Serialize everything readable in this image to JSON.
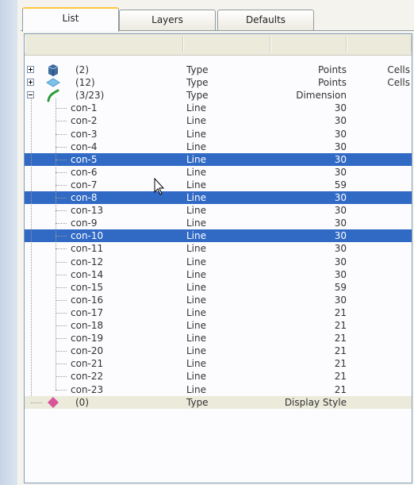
{
  "tabs": [
    {
      "label": "List",
      "active": true
    },
    {
      "label": "Layers",
      "active": false
    },
    {
      "label": "Defaults",
      "active": false
    }
  ],
  "tree": {
    "groups": [
      {
        "name": "(2)",
        "type": "Type",
        "col3": "Points",
        "col4": "Cells",
        "icon": "block-icon",
        "expanded": false
      },
      {
        "name": "(12)",
        "type": "Type",
        "col3": "Points",
        "col4": "Cells",
        "icon": "domain-icon",
        "expanded": false
      },
      {
        "name": "(3/23)",
        "type": "Type",
        "col3": "Dimension",
        "col4": "",
        "icon": "connector-icon",
        "expanded": true
      }
    ],
    "connectors": [
      {
        "name": "con-1",
        "type": "Line",
        "dim": "30",
        "selected": false
      },
      {
        "name": "con-2",
        "type": "Line",
        "dim": "30",
        "selected": false
      },
      {
        "name": "con-3",
        "type": "Line",
        "dim": "30",
        "selected": false
      },
      {
        "name": "con-4",
        "type": "Line",
        "dim": "30",
        "selected": false
      },
      {
        "name": "con-5",
        "type": "Line",
        "dim": "30",
        "selected": true
      },
      {
        "name": "con-6",
        "type": "Line",
        "dim": "30",
        "selected": false
      },
      {
        "name": "con-7",
        "type": "Line",
        "dim": "59",
        "selected": false
      },
      {
        "name": "con-8",
        "type": "Line",
        "dim": "30",
        "selected": true
      },
      {
        "name": "con-13",
        "type": "Line",
        "dim": "30",
        "selected": false
      },
      {
        "name": "con-9",
        "type": "Line",
        "dim": "30",
        "selected": false
      },
      {
        "name": "con-10",
        "type": "Line",
        "dim": "30",
        "selected": true
      },
      {
        "name": "con-11",
        "type": "Line",
        "dim": "30",
        "selected": false
      },
      {
        "name": "con-12",
        "type": "Line",
        "dim": "30",
        "selected": false
      },
      {
        "name": "con-14",
        "type": "Line",
        "dim": "30",
        "selected": false
      },
      {
        "name": "con-15",
        "type": "Line",
        "dim": "59",
        "selected": false
      },
      {
        "name": "con-16",
        "type": "Line",
        "dim": "30",
        "selected": false
      },
      {
        "name": "con-17",
        "type": "Line",
        "dim": "21",
        "selected": false
      },
      {
        "name": "con-18",
        "type": "Line",
        "dim": "21",
        "selected": false
      },
      {
        "name": "con-19",
        "type": "Line",
        "dim": "21",
        "selected": false
      },
      {
        "name": "con-20",
        "type": "Line",
        "dim": "21",
        "selected": false
      },
      {
        "name": "con-21",
        "type": "Line",
        "dim": "21",
        "selected": false
      },
      {
        "name": "con-22",
        "type": "Line",
        "dim": "21",
        "selected": false
      },
      {
        "name": "con-23",
        "type": "Line",
        "dim": "21",
        "selected": false
      }
    ],
    "footer_group": {
      "name": "(0)",
      "type": "Type",
      "col3": "Display Style",
      "icon": "shape-icon"
    }
  },
  "colors": {
    "selection": "#316ac5",
    "block_icon": "#3f6a9c",
    "domain_icon": "#7fc2e8",
    "connector_icon": "#2e9c3a",
    "shape_icon": "#d9559a"
  }
}
